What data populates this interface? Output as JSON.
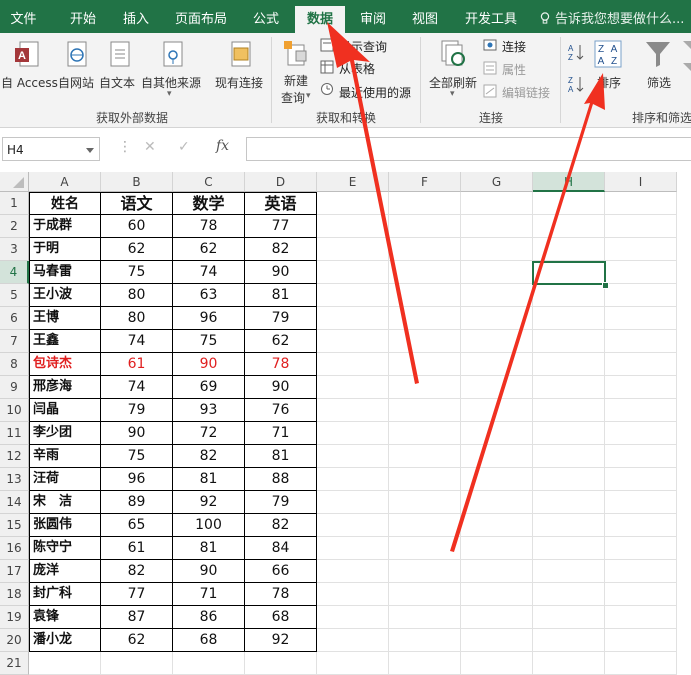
{
  "menu": {
    "tabs": [
      "文件",
      "开始",
      "插入",
      "页面布局",
      "公式",
      "数据",
      "审阅",
      "视图",
      "开发工具"
    ],
    "active": "数据",
    "tell_me": "告诉我您想要做什么..."
  },
  "ribbon": {
    "get_external": {
      "buttons": [
        "自 Access",
        "自网站",
        "自文本",
        "自其他来源",
        "现有连接"
      ],
      "title": "获取外部数据"
    },
    "get_transform": {
      "new_query_l1": "新建",
      "new_query_l2": "查询",
      "show_queries": "显示查询",
      "from_table": "从表格",
      "recent_sources": "最近使用的源",
      "title": "获取和转换"
    },
    "connections": {
      "refresh_all": "全部刷新",
      "connections": "连接",
      "properties": "属性",
      "edit_links": "编辑链接",
      "title": "连接"
    },
    "sort_filter": {
      "sort": "排序",
      "filter": "筛选",
      "title": "排序和筛选"
    }
  },
  "formula_bar": {
    "name_box": "H4",
    "fx": "fx",
    "formula": ""
  },
  "sheet": {
    "columns": [
      "A",
      "B",
      "C",
      "D",
      "E",
      "F",
      "G",
      "H",
      "I"
    ],
    "selected_col": "H",
    "selected_row": "4",
    "rows": [
      "1",
      "2",
      "3",
      "4",
      "5",
      "6",
      "7",
      "8",
      "9",
      "10",
      "11",
      "12",
      "13",
      "14",
      "15",
      "16",
      "17",
      "18",
      "19",
      "20",
      "21"
    ],
    "header": [
      "姓名",
      "语文",
      "数学",
      "英语"
    ],
    "records": [
      [
        "于成群",
        "60",
        "78",
        "77"
      ],
      [
        "于明",
        "62",
        "62",
        "82"
      ],
      [
        "马春雷",
        "75",
        "74",
        "90"
      ],
      [
        "王小波",
        "80",
        "63",
        "81"
      ],
      [
        "王博",
        "80",
        "96",
        "79"
      ],
      [
        "王鑫",
        "74",
        "75",
        "62"
      ],
      [
        "包诗杰",
        "61",
        "90",
        "78"
      ],
      [
        "邢彦海",
        "74",
        "69",
        "90"
      ],
      [
        "闫晶",
        "79",
        "93",
        "76"
      ],
      [
        "李少团",
        "90",
        "72",
        "71"
      ],
      [
        "辛雨",
        "75",
        "82",
        "81"
      ],
      [
        "汪荷",
        "96",
        "81",
        "88"
      ],
      [
        "宋　洁",
        "89",
        "92",
        "79"
      ],
      [
        "张圆伟",
        "65",
        "100",
        "82"
      ],
      [
        "陈守宁",
        "61",
        "81",
        "84"
      ],
      [
        "庞洋",
        "82",
        "90",
        "66"
      ],
      [
        "封广科",
        "77",
        "71",
        "78"
      ],
      [
        "袁锋",
        "87",
        "86",
        "68"
      ],
      [
        "潘小龙",
        "62",
        "68",
        "92"
      ]
    ],
    "highlight_record": 6,
    "highlight_color": "#e02020"
  },
  "colors": {
    "accent": "#217346",
    "arrow": "#f03020"
  }
}
